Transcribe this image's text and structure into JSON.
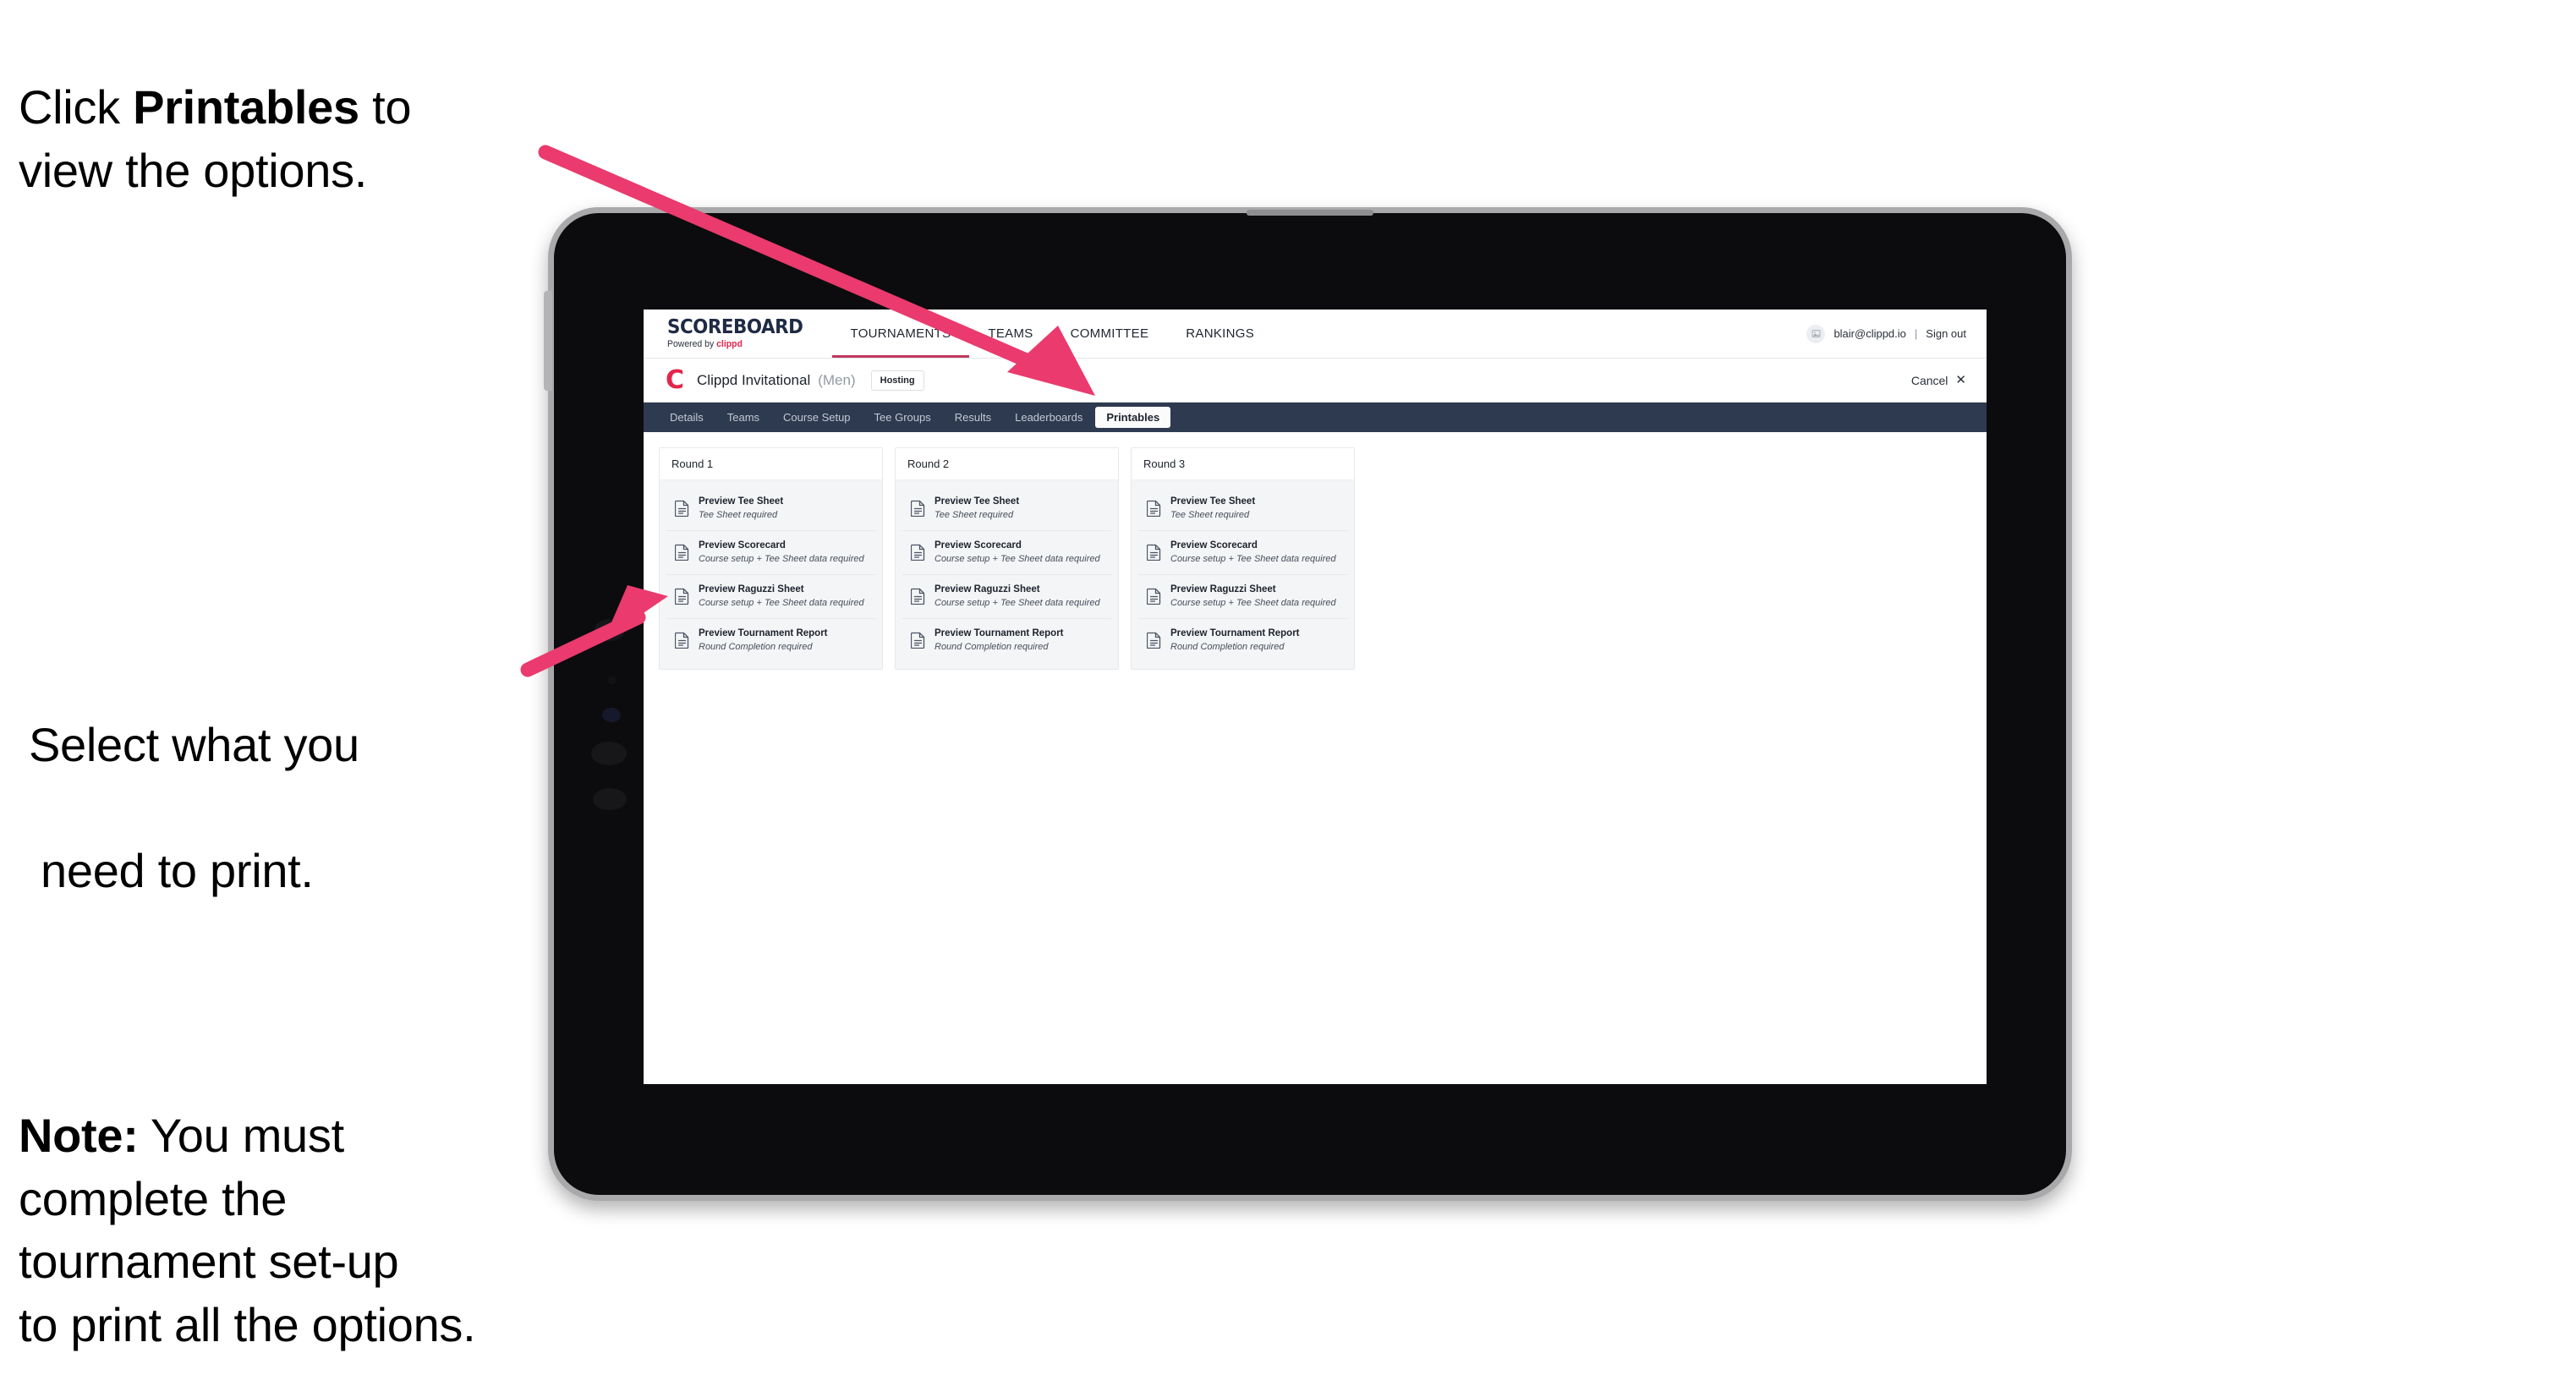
{
  "annotations": {
    "click_printables": {
      "pre": "Click ",
      "strong": "Printables",
      "post": " to\nview the options."
    },
    "select_line1": "Select what you",
    "select_line2": "need to print.",
    "note": {
      "strong": "Note:",
      "rest": " You must\ncomplete the\ntournament set-up\nto print all the options."
    }
  },
  "colors": {
    "arrow_pink": "#ea3a6e",
    "brand_navy": "#1f2b45",
    "clippd_red": "#e3264b",
    "subnav_dark": "#2e3a50",
    "active_tab_underline": "#c0395c"
  },
  "app": {
    "brand": {
      "title": "SCOREBOARD",
      "sub_prefix": "Powered by ",
      "sub_brand": "clippd"
    },
    "topnav": [
      {
        "label": "TOURNAMENTS",
        "active": true
      },
      {
        "label": "TEAMS",
        "active": false
      },
      {
        "label": "COMMITTEE",
        "active": false
      },
      {
        "label": "RANKINGS",
        "active": false
      }
    ],
    "account": {
      "avatar_icon": "user-avatar-icon",
      "email": "blair@clippd.io",
      "separator": "|",
      "sign_out": "Sign out"
    },
    "tournament": {
      "logo_letter": "C",
      "name": "Clippd Invitational",
      "gender": "(Men)",
      "status_badge": "Hosting",
      "cancel_label": "Cancel",
      "cancel_icon": "close-icon"
    },
    "subnav": [
      {
        "label": "Details",
        "active": false
      },
      {
        "label": "Teams",
        "active": false
      },
      {
        "label": "Course Setup",
        "active": false
      },
      {
        "label": "Tee Groups",
        "active": false
      },
      {
        "label": "Results",
        "active": false
      },
      {
        "label": "Leaderboards",
        "active": false
      },
      {
        "label": "Printables",
        "active": true
      }
    ],
    "rounds": [
      {
        "title": "Round 1",
        "items": [
          {
            "title": "Preview Tee Sheet",
            "sub": "Tee Sheet required"
          },
          {
            "title": "Preview Scorecard",
            "sub": "Course setup + Tee Sheet data required"
          },
          {
            "title": "Preview Raguzzi Sheet",
            "sub": "Course setup + Tee Sheet data required"
          },
          {
            "title": "Preview Tournament Report",
            "sub": "Round Completion required"
          }
        ]
      },
      {
        "title": "Round 2",
        "items": [
          {
            "title": "Preview Tee Sheet",
            "sub": "Tee Sheet required"
          },
          {
            "title": "Preview Scorecard",
            "sub": "Course setup + Tee Sheet data required"
          },
          {
            "title": "Preview Raguzzi Sheet",
            "sub": "Course setup + Tee Sheet data required"
          },
          {
            "title": "Preview Tournament Report",
            "sub": "Round Completion required"
          }
        ]
      },
      {
        "title": "Round 3",
        "items": [
          {
            "title": "Preview Tee Sheet",
            "sub": "Tee Sheet required"
          },
          {
            "title": "Preview Scorecard",
            "sub": "Course setup + Tee Sheet data required"
          },
          {
            "title": "Preview Raguzzi Sheet",
            "sub": "Course setup + Tee Sheet data required"
          },
          {
            "title": "Preview Tournament Report",
            "sub": "Round Completion required"
          }
        ]
      }
    ]
  }
}
